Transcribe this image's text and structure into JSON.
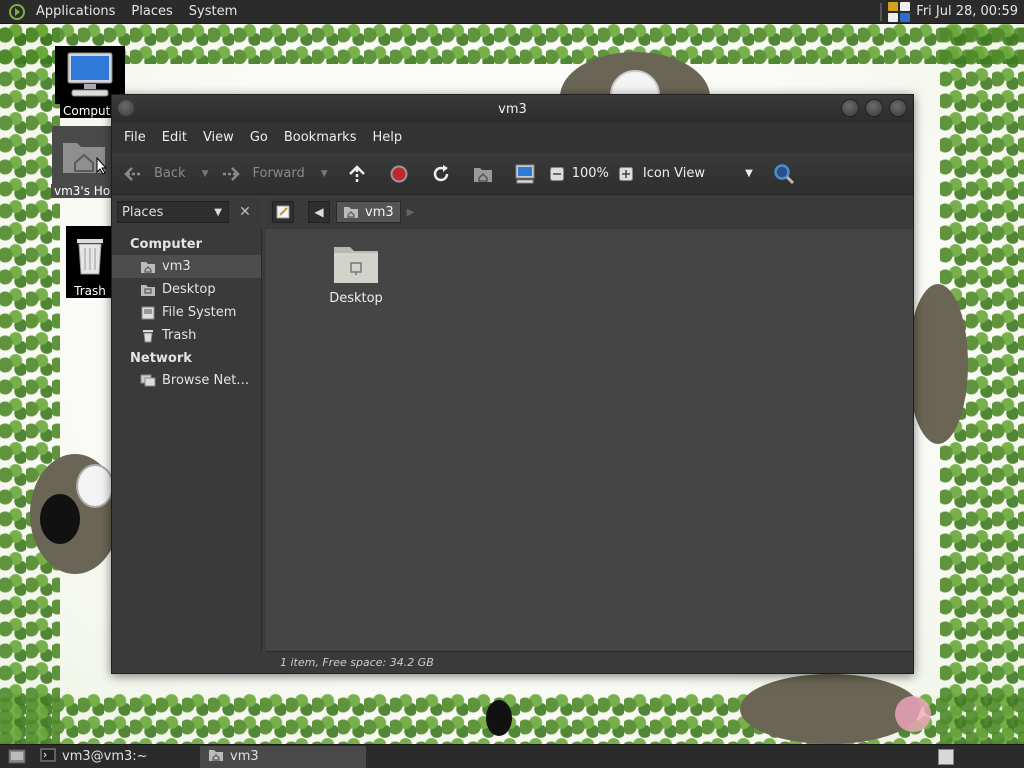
{
  "top_panel": {
    "menus": [
      "Applications",
      "Places",
      "System"
    ],
    "clock": "Fri Jul 28, 00:59"
  },
  "desktop_icons": [
    {
      "label": "Computer",
      "icon": "computer-icon"
    },
    {
      "label": "vm3's Home",
      "icon": "home-folder-icon"
    },
    {
      "label": "Trash",
      "icon": "trash-icon"
    }
  ],
  "window": {
    "title": "vm3",
    "menus": [
      "File",
      "Edit",
      "View",
      "Go",
      "Bookmarks",
      "Help"
    ],
    "toolbar": {
      "back_label": "Back",
      "forward_label": "Forward",
      "zoom": "100%",
      "view_mode": "Icon View"
    },
    "sidebar": {
      "selector": "Places",
      "sections": [
        {
          "heading": "Computer",
          "items": [
            "vm3",
            "Desktop",
            "File System",
            "Trash"
          ]
        },
        {
          "heading": "Network",
          "items": [
            "Browse Net…"
          ]
        }
      ]
    },
    "path": {
      "current": "vm3"
    },
    "files": [
      {
        "name": "Desktop"
      }
    ],
    "status": "1 item, Free space: 34.2 GB"
  },
  "taskbar": {
    "tasks": [
      {
        "label": "vm3@vm3:~",
        "icon": "terminal-icon",
        "active": false
      },
      {
        "label": "vm3",
        "icon": "home-folder-icon",
        "active": true
      }
    ]
  },
  "colors": {
    "panel": "#2b2b2b",
    "window_bg": "#3c3c3c",
    "content_bg": "#454545",
    "stop_red": "#c0272d",
    "accent_blue": "#4a8fd6"
  }
}
